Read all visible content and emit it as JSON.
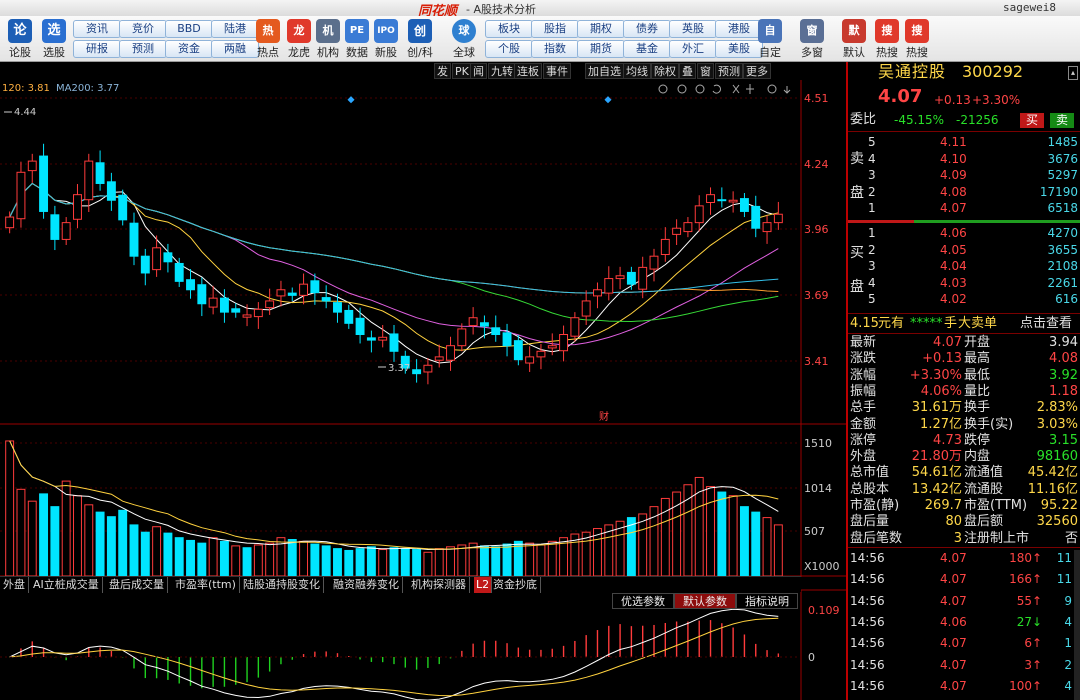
{
  "window": {
    "logo": "同花顺",
    "title": "- A股技术分析",
    "user": "sagewei8"
  },
  "toolbar": {
    "left_big": [
      {
        "label": "论股",
        "icon": "论"
      },
      {
        "label": "选股",
        "icon": "选"
      }
    ],
    "text_buttons_row1": [
      "资讯",
      "竞价",
      "BBD",
      "陆港"
    ],
    "text_buttons_row2": [
      "研报",
      "预测",
      "资金",
      "两融"
    ],
    "mid_big": [
      {
        "label": "热点",
        "icon": "热"
      },
      {
        "label": "龙虎",
        "icon": "龙"
      },
      {
        "label": "机构",
        "icon": "机"
      },
      {
        "label": "数据",
        "icon": "PE"
      },
      {
        "label": "新股",
        "icon": "IPO"
      },
      {
        "label": "创/科",
        "icon": "创"
      },
      {
        "label": "全球",
        "icon": "球"
      }
    ],
    "text_buttons_row3": [
      "板块",
      "股指",
      "期权",
      "债券",
      "英股",
      "港股"
    ],
    "text_buttons_row4": [
      "个股",
      "指数",
      "期货",
      "基金",
      "外汇",
      "美股"
    ],
    "right_big": [
      {
        "label": "自定",
        "icon": "自"
      },
      {
        "label": "多窗",
        "icon": "窗"
      },
      {
        "label": "默认",
        "icon": "默"
      },
      {
        "label": "热搜",
        "icon": "搜"
      },
      {
        "label": "热搜",
        "icon": "搜"
      }
    ]
  },
  "chart_toolbar": [
    "发",
    "PK",
    "闻",
    "九转",
    "连板",
    "事件",
    "加自选",
    "均线",
    "除权",
    "叠",
    "窗",
    "预测",
    "更多"
  ],
  "ma_legend": {
    "ma120": "120: 3.81",
    "ma200": "MA200: 3.77"
  },
  "chart_data": [
    {
      "type": "candlestick",
      "title": "",
      "ylim": [
        3.32,
        4.55
      ],
      "y_ticks": [
        "4.51",
        "4.24",
        "3.96",
        "3.69",
        "3.41"
      ],
      "annotations": {
        "high": "4.44",
        "low": "3.37",
        "event": "财"
      },
      "close_series": [
        4.06,
        4.22,
        4.26,
        4.08,
        3.98,
        4.04,
        4.14,
        4.26,
        4.18,
        4.12,
        4.05,
        3.92,
        3.86,
        3.95,
        3.9,
        3.83,
        3.8,
        3.75,
        3.77,
        3.72,
        3.72,
        3.71,
        3.73,
        3.76,
        3.8,
        3.78,
        3.82,
        3.79,
        3.76,
        3.72,
        3.68,
        3.64,
        3.62,
        3.63,
        3.58,
        3.52,
        3.5,
        3.53,
        3.56,
        3.6,
        3.66,
        3.7,
        3.67,
        3.64,
        3.6,
        3.55,
        3.56,
        3.58,
        3.6,
        3.64,
        3.7,
        3.76,
        3.8,
        3.84,
        3.85,
        3.82,
        3.88,
        3.92,
        3.98,
        4.02,
        4.04,
        4.1,
        4.14,
        4.12,
        4.12,
        4.08,
        4.02,
        4.04,
        4.07
      ]
    },
    {
      "type": "bar",
      "title": "",
      "y_ticks": [
        "1510",
        "1014",
        "507"
      ],
      "unit": "X1000",
      "values": [
        1480,
        950,
        820,
        900,
        760,
        1040,
        880,
        780,
        700,
        650,
        720,
        560,
        480,
        540,
        470,
        420,
        390,
        360,
        420,
        380,
        330,
        310,
        340,
        360,
        420,
        400,
        380,
        350,
        330,
        300,
        280,
        300,
        320,
        290,
        310,
        300,
        290,
        260,
        300,
        320,
        340,
        360,
        330,
        320,
        350,
        380,
        360,
        340,
        380,
        420,
        460,
        480,
        520,
        560,
        600,
        640,
        680,
        760,
        850,
        920,
        1000,
        1080,
        980,
        920,
        880,
        760,
        700,
        640,
        560
      ]
    },
    {
      "type": "line",
      "title": "",
      "y_ticks": [
        "0.109",
        "0"
      ],
      "note": "MACD-style oscillator with histogram bars"
    }
  ],
  "indicator_tabs": [
    "外盘",
    "AI立桩成交量",
    "盘后成交量",
    "市盈率(ttm)",
    "陆股通持股变化",
    "融资融券变化",
    "机构探测器",
    "L2",
    "资金抄底"
  ],
  "param_tabs": [
    "优选参数",
    "默认参数",
    "指标说明"
  ],
  "quote": {
    "name": "吴通控股",
    "code": "300292",
    "price": "4.07",
    "change": "+0.13",
    "change_pct": "+3.30%",
    "weibi_label": "委比",
    "weibi": "-45.15%",
    "weicha": "-21256",
    "buy_btn": "买",
    "sell_btn": "卖",
    "sell_side_label": [
      "卖",
      "盘"
    ],
    "buy_side_label": [
      "买",
      "盘"
    ],
    "asks": [
      {
        "level": "5",
        "price": "4.11",
        "vol": "1485"
      },
      {
        "level": "4",
        "price": "4.10",
        "vol": "3676"
      },
      {
        "level": "3",
        "price": "4.09",
        "vol": "5297"
      },
      {
        "level": "2",
        "price": "4.08",
        "vol": "17190"
      },
      {
        "level": "1",
        "price": "4.07",
        "vol": "6518"
      }
    ],
    "bids": [
      {
        "level": "1",
        "price": "4.06",
        "vol": "4270"
      },
      {
        "level": "2",
        "price": "4.05",
        "vol": "3655"
      },
      {
        "level": "3",
        "price": "4.04",
        "vol": "2108"
      },
      {
        "level": "4",
        "price": "4.03",
        "vol": "2261"
      },
      {
        "level": "5",
        "price": "4.02",
        "vol": "616"
      }
    ],
    "bigorder": {
      "price": "4.15",
      "unit": "元有",
      "stars": "*****",
      "hand": "手",
      "label": "大卖单",
      "action": "点击查看"
    },
    "stats": [
      {
        "k1": "最新",
        "v1": "4.07",
        "c1": "red",
        "k2": "开盘",
        "v2": "3.94",
        "c2": "wht"
      },
      {
        "k1": "涨跌",
        "v1": "+0.13",
        "c1": "red",
        "k2": "最高",
        "v2": "4.08",
        "c2": "red"
      },
      {
        "k1": "涨幅",
        "v1": "+3.30%",
        "c1": "red",
        "k2": "最低",
        "v2": "3.92",
        "c2": "grn"
      },
      {
        "k1": "振幅",
        "v1": "4.06%",
        "c1": "red",
        "k2": "量比",
        "v2": "1.18",
        "c2": "red"
      },
      {
        "k1": "总手",
        "v1": "31.61万",
        "c1": "yel",
        "k2": "换手",
        "v2": "2.83%",
        "c2": "yel"
      },
      {
        "k1": "金额",
        "v1": "1.27亿",
        "c1": "yel",
        "k2": "换手(实)",
        "v2": "3.03%",
        "c2": "yel"
      },
      {
        "k1": "涨停",
        "v1": "4.73",
        "c1": "red",
        "k2": "跌停",
        "v2": "3.15",
        "c2": "grn"
      },
      {
        "k1": "外盘",
        "v1": "21.80万",
        "c1": "red",
        "k2": "内盘",
        "v2": "98160",
        "c2": "grn"
      },
      {
        "k1": "总市值",
        "v1": "54.61亿",
        "c1": "yel",
        "k2": "流通值",
        "v2": "45.42亿",
        "c2": "yel"
      },
      {
        "k1": "总股本",
        "v1": "13.42亿",
        "c1": "yel",
        "k2": "流通股",
        "v2": "11.16亿",
        "c2": "yel"
      },
      {
        "k1": "市盈(静)",
        "v1": "269.7",
        "c1": "yel",
        "k2": "市盈(TTM)",
        "v2": "95.22",
        "c2": "yel"
      },
      {
        "k1": "盘后量",
        "v1": "80",
        "c1": "yel",
        "k2": "盘后额",
        "v2": "32560",
        "c2": "yel"
      },
      {
        "k1": "盘后笔数",
        "v1": "3",
        "c1": "yel",
        "k2": "注册制上市",
        "v2": "否",
        "c2": "wht"
      }
    ],
    "ticks": [
      {
        "time": "14:56",
        "price": "4.07",
        "vol": "180",
        "dir": "up",
        "num": "11"
      },
      {
        "time": "14:56",
        "price": "4.07",
        "vol": "166",
        "dir": "up",
        "num": "11"
      },
      {
        "time": "14:56",
        "price": "4.07",
        "vol": "55",
        "dir": "up",
        "num": "9"
      },
      {
        "time": "14:56",
        "price": "4.06",
        "vol": "27",
        "dir": "down",
        "num": "4"
      },
      {
        "time": "14:56",
        "price": "4.07",
        "vol": "6",
        "dir": "up",
        "num": "1"
      },
      {
        "time": "14:56",
        "price": "4.07",
        "vol": "3",
        "dir": "up",
        "num": "2"
      },
      {
        "time": "14:56",
        "price": "4.07",
        "vol": "100",
        "dir": "up",
        "num": "4"
      }
    ]
  },
  "colors": {
    "up": "#ff3b3b",
    "down": "#00e5ff",
    "bg": "#000000",
    "ma5": "#ffffff",
    "ma10": "#ffd23f",
    "ma20": "#e060e0",
    "ma60": "#36d836",
    "ma120": "#ff9d2e",
    "ma200": "#33bfe8"
  }
}
